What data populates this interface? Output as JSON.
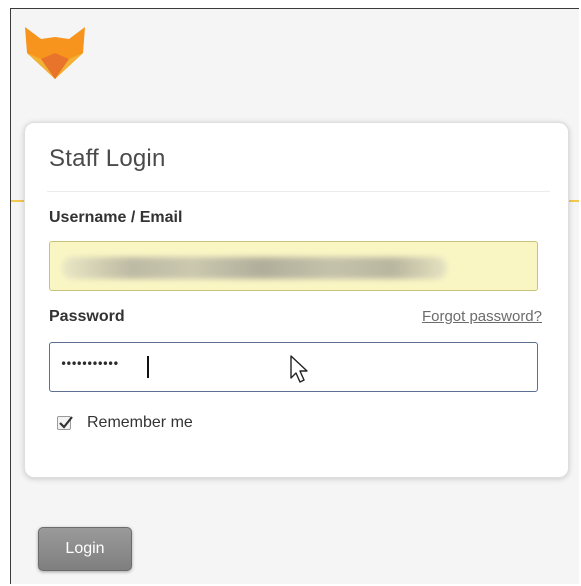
{
  "logo": {
    "icon": "fox-logo-icon",
    "colors": [
      "#f7a623",
      "#f7941d",
      "#e8732a"
    ]
  },
  "login_card": {
    "title": "Staff Login",
    "username": {
      "label": "Username / Email",
      "value": "",
      "obscured": true
    },
    "password": {
      "label": "Password",
      "masked_value": "•••••••••••",
      "forgot_link": "Forgot password?"
    },
    "remember_me": {
      "label": "Remember me",
      "checked": true
    }
  },
  "login_button": {
    "label": "Login"
  },
  "colors": {
    "accent": "#f2c94c",
    "autofill_bg": "#faf6c4",
    "focus_border": "#5d6f93",
    "button_gray": "#8a8a8a"
  }
}
